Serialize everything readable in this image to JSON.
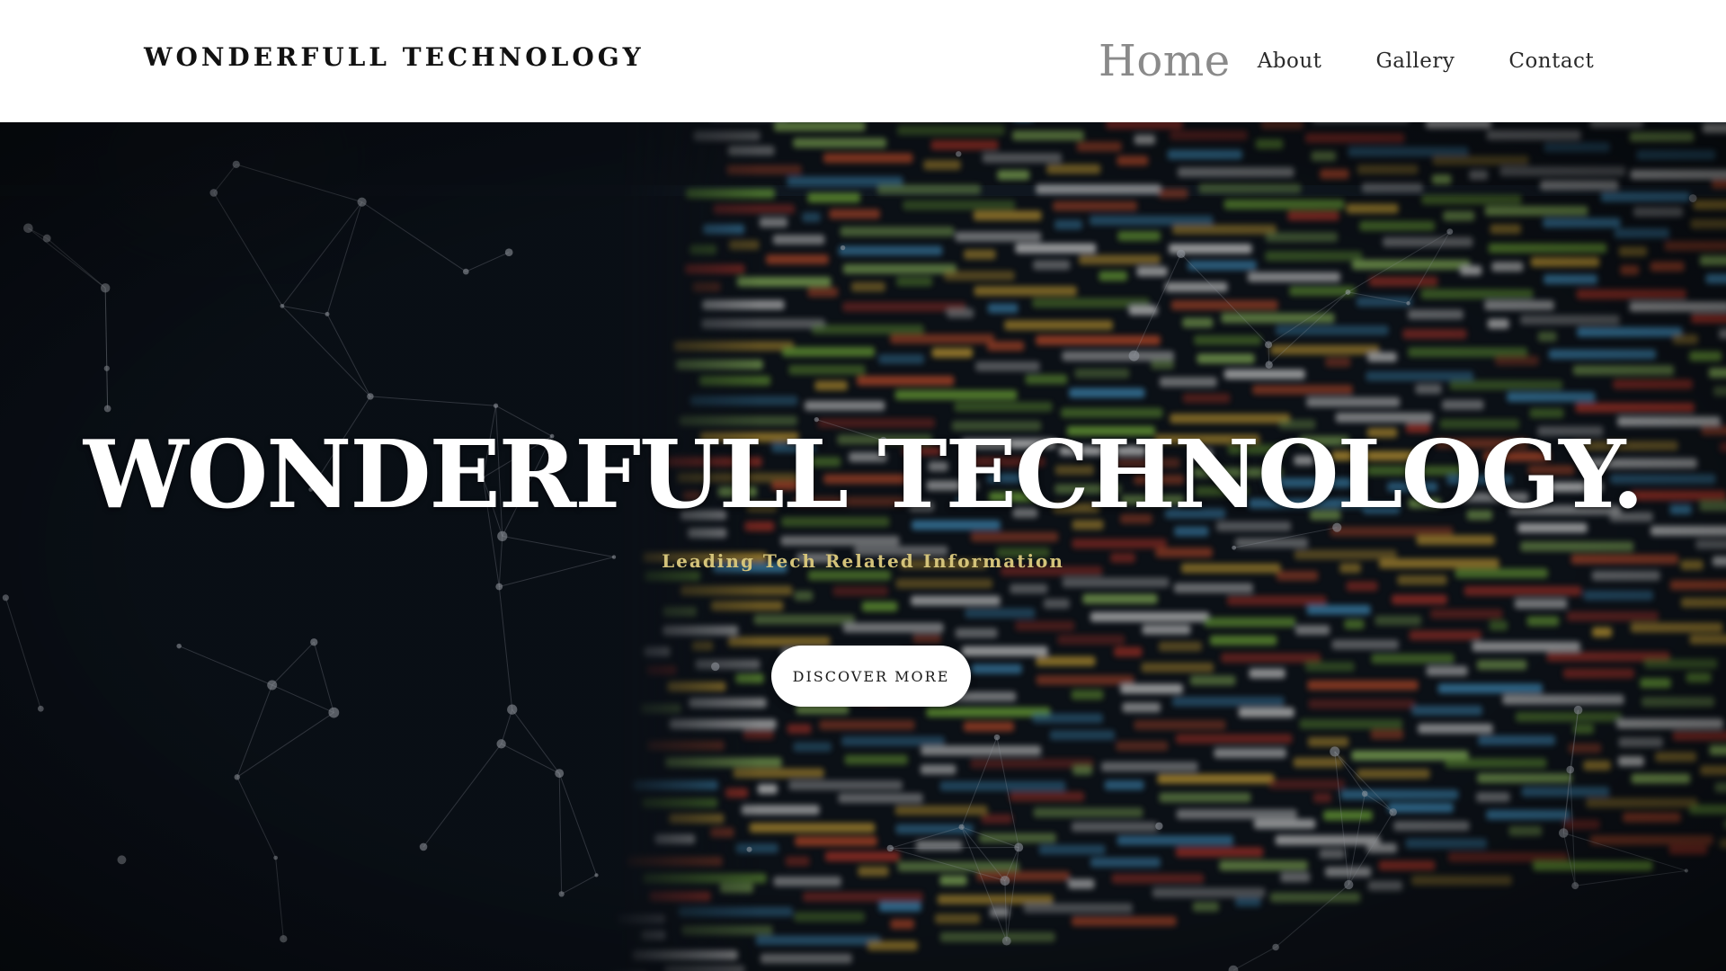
{
  "header": {
    "brand": "WONDERFULL TECHNOLOGY",
    "nav": [
      {
        "label": "Home",
        "active": true
      },
      {
        "label": "About",
        "active": false
      },
      {
        "label": "Gallery",
        "active": false
      },
      {
        "label": "Contact",
        "active": false
      }
    ]
  },
  "hero": {
    "title": "WONDERFULL TECHNOLOGY.",
    "subtitle": "Leading Tech Related Information",
    "cta_label": "DISCOVER MORE",
    "background": "blurred-code-screen-with-network-particles"
  },
  "colors": {
    "header_bg": "#ffffff",
    "brand_text": "#111111",
    "nav_active": "#8a8a8a",
    "nav_text": "#2a2a2a",
    "hero_overlay": "#0b1018",
    "subtitle": "#d4c37a",
    "cta_bg": "#ffffff"
  }
}
